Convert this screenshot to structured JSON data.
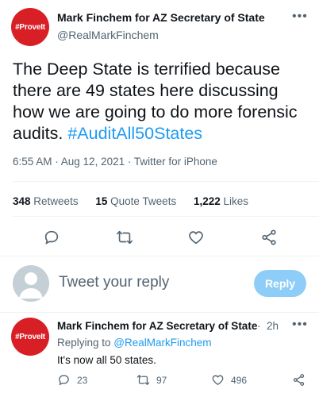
{
  "tweet": {
    "avatar_text": "#ProveIt",
    "display_name": "Mark Finchem for AZ Secretary of State",
    "handle": "@RealMarkFinchem",
    "more_icon": "more-horizontal-icon",
    "text_main": "The Deep State is terrified because there are 49 states here discussing how we are going to do more forensic audits. ",
    "hashtag": "#AuditAll50States",
    "timestamp": "6:55 AM · Aug 12, 2021 · Twitter for iPhone",
    "stats": {
      "retweets_count": "348",
      "retweets_label": "Retweets",
      "quotes_count": "15",
      "quotes_label": "Quote Tweets",
      "likes_count": "1,222",
      "likes_label": "Likes"
    },
    "actions": [
      "reply-icon",
      "retweet-icon",
      "like-icon",
      "share-icon"
    ]
  },
  "compose": {
    "placeholder": "Tweet your reply",
    "button_label": "Reply"
  },
  "reply": {
    "avatar_text": "#ProveIt",
    "display_name": "Mark Finchem for AZ Secretary of State",
    "dot": "·",
    "time": "2h",
    "replying_prefix": "Replying to ",
    "replying_handle": "@RealMarkFinchem",
    "text": "It's now all 50 states.",
    "reply_count": "23",
    "retweet_count": "97",
    "like_count": "496"
  },
  "colors": {
    "accent": "#1d9bf0",
    "avatar_red": "#d81f26",
    "muted": "#536471"
  }
}
